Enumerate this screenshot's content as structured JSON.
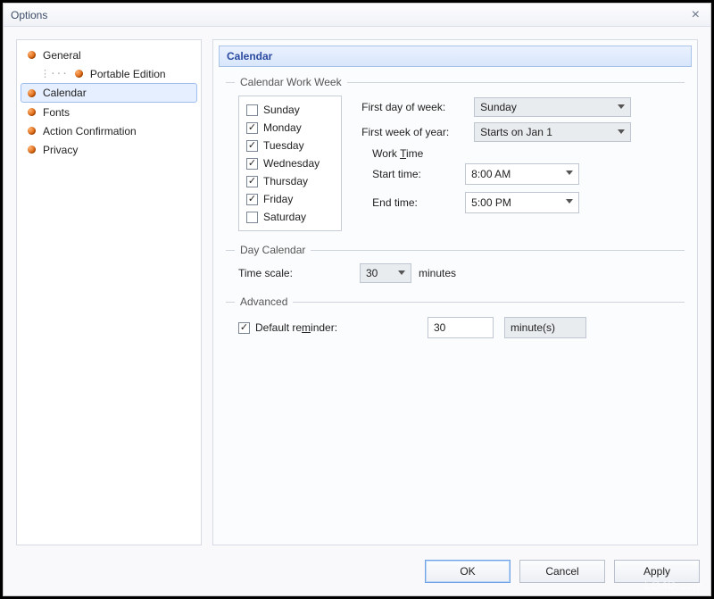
{
  "window": {
    "title": "Options"
  },
  "sidebar": {
    "items": [
      {
        "label": "General"
      },
      {
        "label": "Portable Edition"
      },
      {
        "label": "Calendar"
      },
      {
        "label": "Fonts"
      },
      {
        "label": "Action Confirmation"
      },
      {
        "label": "Privacy"
      }
    ],
    "selected_index": 2
  },
  "panel": {
    "title": "Calendar",
    "workweek": {
      "legend": "Calendar Work Week",
      "days": [
        {
          "label": "Sunday",
          "checked": false
        },
        {
          "label": "Monday",
          "checked": true
        },
        {
          "label": "Tuesday",
          "checked": true
        },
        {
          "label": "Wednesday",
          "checked": true
        },
        {
          "label": "Thursday",
          "checked": true
        },
        {
          "label": "Friday",
          "checked": true
        },
        {
          "label": "Saturday",
          "checked": false
        }
      ],
      "first_day_label": "First day of week:",
      "first_day_value": "Sunday",
      "first_week_label": "First week of year:",
      "first_week_value": "Starts on Jan 1",
      "worktime_label": "Work Time",
      "start_label": "Start time:",
      "start_value": "8:00 AM",
      "end_label": "End time:",
      "end_value": "5:00 PM"
    },
    "daycalendar": {
      "legend": "Day Calendar",
      "timescale_label": "Time scale:",
      "timescale_value": "30",
      "timescale_unit": "minutes"
    },
    "advanced": {
      "legend": "Advanced",
      "reminder_checked": true,
      "reminder_label": "Default reminder:",
      "reminder_value": "30",
      "reminder_unit": "minute(s)"
    }
  },
  "buttons": {
    "ok": "OK",
    "cancel": "Cancel",
    "apply": "Apply"
  },
  "watermark": "LO4D.com"
}
